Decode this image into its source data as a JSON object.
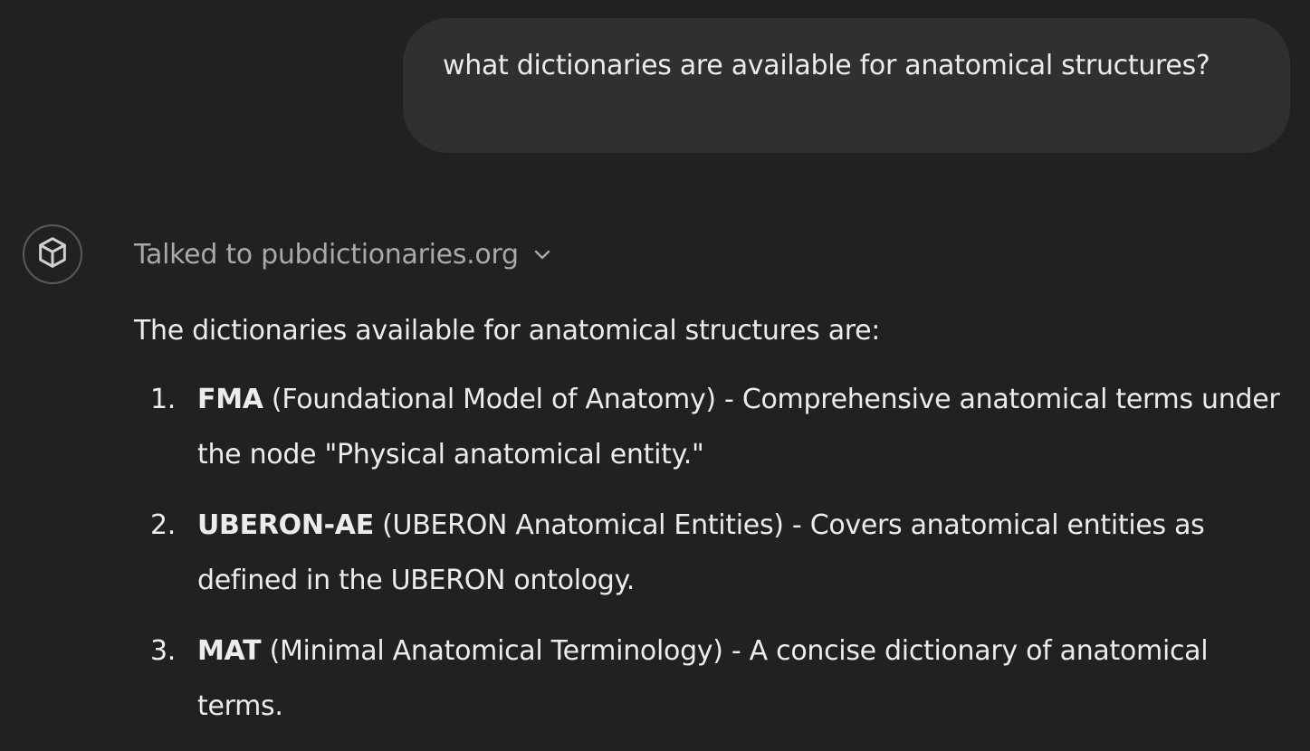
{
  "user_message": {
    "text": "what dictionaries are available for anatomical structures?"
  },
  "assistant": {
    "avatar_icon": "cube-icon",
    "tool_call_label": "Talked to pubdictionaries.org",
    "tool_call_icon": "chevron-down-icon",
    "intro": "The dictionaries available for anatomical structures are:",
    "items": [
      {
        "number": "1.",
        "name": "FMA",
        "description": "(Foundational Model of Anatomy) - Comprehensive anatomical terms under the node \"Physical anatomical entity.\""
      },
      {
        "number": "2.",
        "name": "UBERON-AE",
        "description": "(UBERON Anatomical Entities) - Covers anatomical entities as defined in the UBERON ontology."
      },
      {
        "number": "3.",
        "name": "MAT",
        "description": "(Minimal Anatomical Terminology) - A concise dictionary of anatomical terms."
      }
    ]
  },
  "colors": {
    "background": "#212121",
    "user_bubble": "#303030",
    "text": "#ececec",
    "muted_text": "#a9a9a9"
  }
}
